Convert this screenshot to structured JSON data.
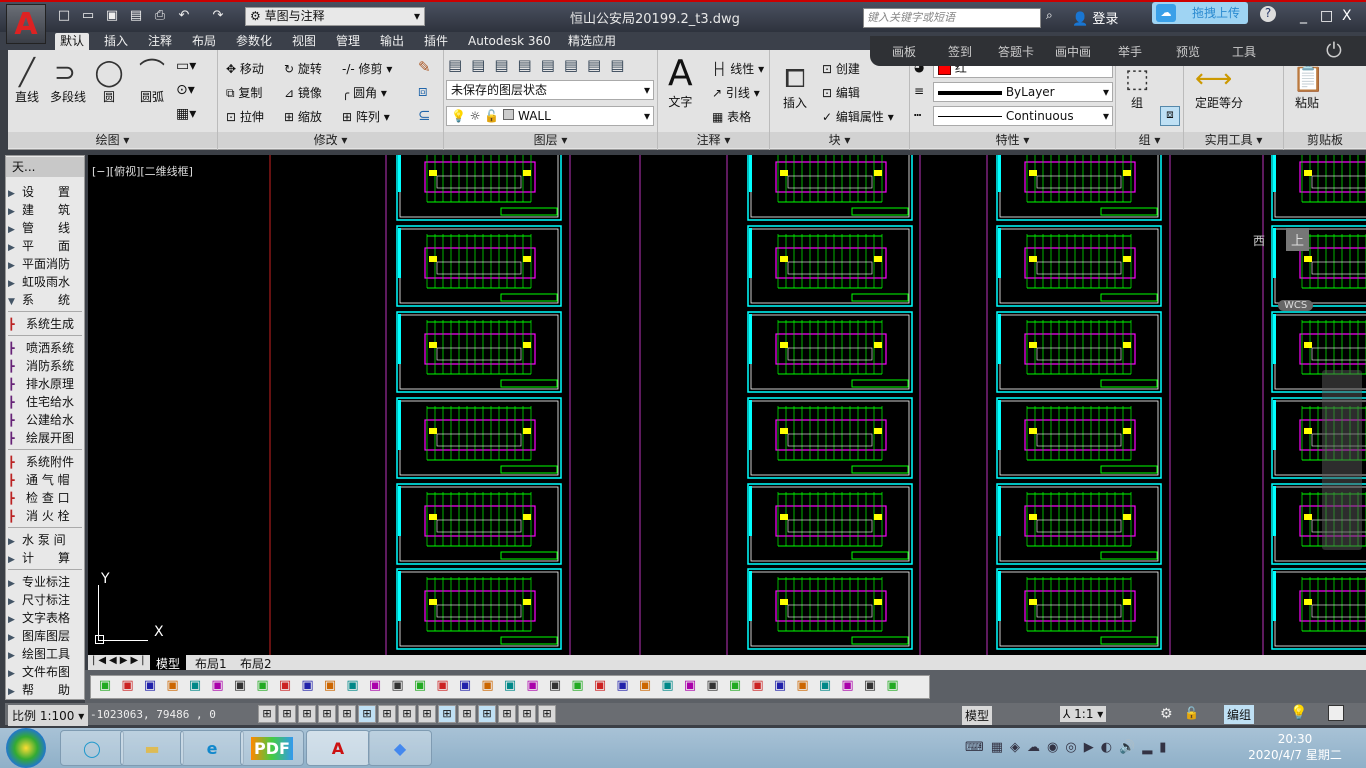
{
  "titlebar": {
    "workspace": "草图与注释",
    "title": "恒山公安局20199.2_t3.dwg",
    "search_placeholder": "键入关键字或短语",
    "login": "登录",
    "upload": "拖拽上传",
    "help": "?"
  },
  "tabs": [
    "默认",
    "插入",
    "注释",
    "布局",
    "参数化",
    "视图",
    "管理",
    "输出",
    "插件",
    "Autodesk 360",
    "精选应用"
  ],
  "overlay": [
    "画板",
    "签到",
    "答题卡",
    "画中画",
    "举手",
    "预览",
    "工具"
  ],
  "ribbon": {
    "draw": {
      "label": "绘图 ▾",
      "items": [
        "直线",
        "多段线",
        "圆",
        "圆弧"
      ]
    },
    "modify": {
      "label": "修改 ▾",
      "items": [
        "移动",
        "旋转",
        "修剪",
        "复制",
        "镜像",
        "圆角",
        "拉伸",
        "缩放",
        "阵列"
      ]
    },
    "layers": {
      "label": "图层 ▾",
      "layer_state": "未保存的图层状态",
      "current_layer": "WALL"
    },
    "annotation": {
      "label": "注释 ▾",
      "text": "文字",
      "items": [
        "线性",
        "引线",
        "表格"
      ]
    },
    "block": {
      "label": "块 ▾",
      "insert": "插入",
      "items": [
        "创建",
        "编辑",
        "编辑属性"
      ]
    },
    "properties": {
      "label": "特性 ▾",
      "color": "红",
      "color_hex": "#ff0000",
      "lineweight": "ByLayer",
      "linetype": "Continuous"
    },
    "group": {
      "label": "组 ▾",
      "group": "组"
    },
    "utilities": {
      "label": "实用工具 ▾",
      "measure": "定距等分"
    },
    "clipboard": {
      "label": "剪贴板",
      "paste": "粘贴"
    }
  },
  "leftpanel": {
    "title": "天...",
    "menus1": [
      "设　　置",
      "建　　筑",
      "管　　线",
      "平　　面",
      "平面消防",
      "虹吸雨水",
      "系　　统"
    ],
    "sys": [
      "系统生成"
    ],
    "systems": [
      "喷洒系统",
      "消防系统",
      "排水原理",
      "住宅给水",
      "公建给水",
      "绘展开图"
    ],
    "parts": [
      "系统附件",
      "通 气 帽",
      "检 查 口",
      "消 火 栓"
    ],
    "menus2": [
      "水 泵 间",
      "计　　算"
    ],
    "menus3": [
      "专业标注",
      "尺寸标注",
      "文字表格",
      "图库图层",
      "绘图工具",
      "文件布图",
      "帮　　助"
    ]
  },
  "canvas": {
    "view_label": "[−][俯视][二维线框]",
    "viewcube": {
      "west": "西",
      "top": "上",
      "wcs": "WCS"
    },
    "ucs_x": "X",
    "ucs_y": "Y"
  },
  "layout_tabs": [
    "模型",
    "布局1",
    "布局2"
  ],
  "status": {
    "scale": "比例 1:100",
    "coords": "-1023063,  79486   ,  0",
    "model": "模型",
    "annoscale": "1:1",
    "group_edit": "编组"
  },
  "taskbar": {
    "apps": [
      "QQ浏览器",
      "文件管理器",
      "IE",
      "PDF",
      "AutoCAD",
      "视频"
    ],
    "time": "20:30",
    "date": "2020/4/7 星期二"
  }
}
